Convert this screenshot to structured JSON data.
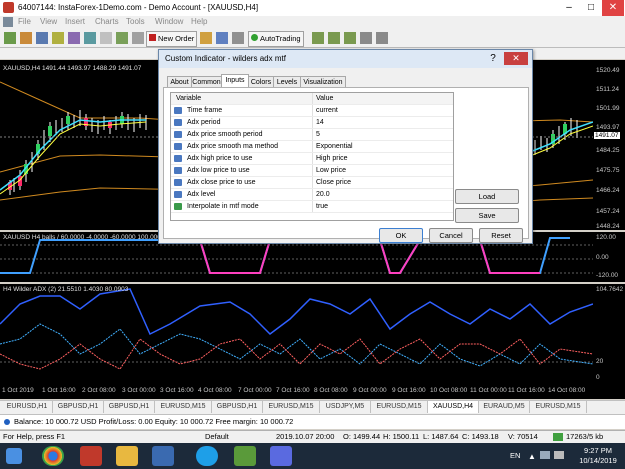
{
  "window": {
    "title": "64007144: InstaForex-1Demo.com - Demo Account - [XAUUSD,H4]"
  },
  "menu": [
    "File",
    "View",
    "Insert",
    "Charts",
    "Tools",
    "Window",
    "Help"
  ],
  "toolbar": {
    "new_order": "New Order",
    "autotrading": "AutoTrading"
  },
  "chart": {
    "header_main": "XAUUSD,H4  1491.44 1493.97 1488.29 1491.07",
    "header_sub1": "XAUUSD H4  balls / 60.0000 -4.0000 -60.0000 100.0000 1",
    "header_sub2": "H4 Wilder ADX (2) 21.5510 1.4030 80.0903",
    "price_labels": [
      "1520.49",
      "1511.24",
      "1501.99",
      "1493.97",
      "1491.07",
      "1484.25",
      "1475.75",
      "1466.24",
      "1457.24",
      "1448.24"
    ],
    "current_price": "1491.07",
    "sub1_labels": [
      "120.00",
      "0.00",
      "-120.00"
    ],
    "sub2_labels": [
      "104.7642",
      "20",
      "0"
    ],
    "time_labels": [
      "1 Oct 2019",
      "1 Oct 16:00",
      "2 Oct 08:00",
      "3 Oct 00:00",
      "3 Oct 16:00",
      "4 Oct 08:00",
      "7 Oct 00:00",
      "7 Oct 16:00",
      "8 Oct 08:00",
      "9 Oct 00:00",
      "9 Oct 16:00",
      "10 Oct 08:00",
      "11 Oct 00:00",
      "11 Oct 16:00",
      "14 Oct 08:00"
    ]
  },
  "dialog": {
    "title": "Custom Indicator - wilders adx mtf",
    "tabs": [
      "About",
      "Common",
      "Inputs",
      "Colors",
      "Levels",
      "Visualization"
    ],
    "active_tab": "Inputs",
    "columns": {
      "variable": "Variable",
      "value": "Value"
    },
    "rows": [
      {
        "variable": "Time frame",
        "value": "current"
      },
      {
        "variable": "Adx period",
        "value": "14"
      },
      {
        "variable": "Adx price smooth period",
        "value": "5"
      },
      {
        "variable": "Adx price smooth ma method",
        "value": "Exponential"
      },
      {
        "variable": "Adx high price to use",
        "value": "High price"
      },
      {
        "variable": "Adx low price to use",
        "value": "Low price"
      },
      {
        "variable": "Adx close price to use",
        "value": "Close price"
      },
      {
        "variable": "Adx level",
        "value": "20.0"
      },
      {
        "variable": "Interpolate in mtf mode",
        "value": "true"
      }
    ],
    "buttons": {
      "load": "Load",
      "save": "Save",
      "ok": "OK",
      "cancel": "Cancel",
      "reset": "Reset"
    }
  },
  "symbol_tabs": [
    "EURUSD,H1",
    "GBPUSD,H1",
    "GBPUSD,H1",
    "EURUSD,M15",
    "GBPUSD,H1",
    "EURUSD,M15",
    "USDJPY,M5",
    "EURUSD,M15",
    "XAUUSD,H4",
    "EURAUD,M5",
    "EURUSD,M15"
  ],
  "active_symbol_tab": "XAUUSD,H4",
  "account": {
    "text": "Balance: 10 000.72 USD  Profit/Loss: 0.00  Equity: 10 000.72  Free margin: 10 000.72"
  },
  "status": {
    "help": "For Help, press F1",
    "profile": "Default",
    "time": "2019.10.07 20:00",
    "open": "O: 1499.44",
    "high": "H: 1500.11",
    "low": "L: 1487.64",
    "close": "C: 1493.18",
    "volume": "V: 70514",
    "traffic": "17263/5 kb"
  },
  "taskbar": {
    "lang": "EN",
    "clock_time": "9:27 PM",
    "clock_date": "10/14/2019"
  }
}
